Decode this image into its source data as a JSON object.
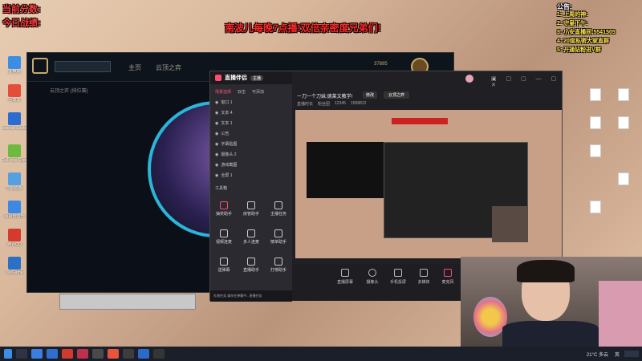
{
  "overlay": {
    "score_label": "当前分数:",
    "today_label": "今日战绩:",
    "announcement": "南波儿每晚7点播!双倍亲密度兄弟们!",
    "notice_title": "公告:",
    "notice_items": [
      "1: 上周的神:",
      "2: 守皇下午:",
      "3: 小安直播间:5541505",
      "4: 20级私密大家直群",
      "5: 开通钻粉进V群"
    ]
  },
  "desktop_icons": [
    "此电脑",
    "回收站",
    "Internet Explorer",
    "GeForce Experience",
    "控制面板",
    "网易云音乐",
    "腾讯QQ",
    "WeGame"
  ],
  "lol": {
    "nav": [
      "主页",
      "云顶之弈"
    ],
    "sub": "云顶之弈 (排位赛)",
    "currency": "37895"
  },
  "stream_app": {
    "title": "直播伴侣",
    "title_badge": "主播",
    "tabs": [
      "场景选择",
      "双击",
      "可添加"
    ],
    "sources": [
      "窗口 1",
      "文本 4",
      "文本 1",
      "公告",
      "字幕贴图",
      "摄像头 2",
      "游戏截图",
      "全屏 1"
    ],
    "tools_title": "工具箱",
    "tools": [
      "抽奖助手",
      "房管助手",
      "主播任务",
      "视频连麦",
      "多人连麦",
      "榜单助手",
      "送弹幕",
      "直播助手",
      "打榜助手"
    ],
    "stream_title": "一刀一个刀妹,德莱文教学!",
    "stream_tag": "修改",
    "category": "云顶之弈",
    "stats": [
      "直播时长",
      "粉丝团",
      "12345",
      "1558812"
    ],
    "bottom": [
      "直播屏幕",
      "摄像头",
      "手机投屏",
      "多媒体",
      "麦克风"
    ],
    "tip": "礼物任务,请勿在弹幕中...直播任务"
  },
  "taskbar": {
    "weather": "21°C 多云",
    "lang": "英"
  }
}
